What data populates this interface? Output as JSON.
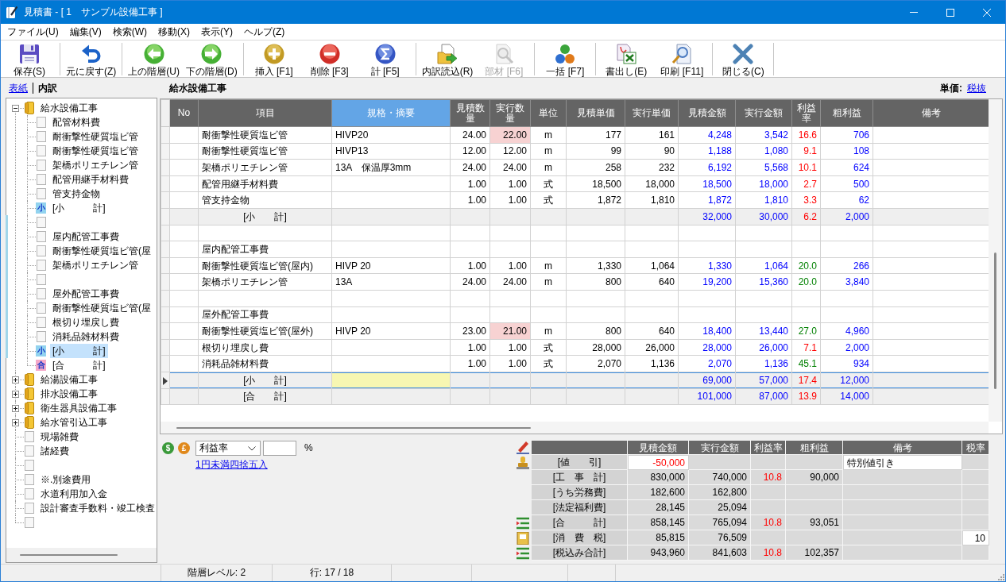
{
  "window": {
    "title": "見積書 - [ 1　サンプル設備工事 ]"
  },
  "menu": [
    "ファイル(U)",
    "編集(V)",
    "検索(W)",
    "移動(X)",
    "表示(Y)",
    "ヘルプ(Z)"
  ],
  "toolbar": [
    [
      {
        "kind": "save",
        "label": "保存(S)",
        "disabled": false
      }
    ],
    [
      {
        "kind": "undo",
        "label": "元に戻す(Z)",
        "disabled": false
      }
    ],
    [
      {
        "kind": "up",
        "label": "上の階層(U)",
        "disabled": false
      },
      {
        "kind": "down",
        "label": "下の階層(D)",
        "disabled": false
      }
    ],
    [
      {
        "kind": "insert",
        "label": "挿入 [F1]",
        "disabled": false
      },
      {
        "kind": "delete",
        "label": "削除 [F3]",
        "disabled": false
      },
      {
        "kind": "sum",
        "label": "計 [F5]",
        "disabled": false
      }
    ],
    [
      {
        "kind": "import",
        "label": "内訳読込(R)",
        "disabled": false
      },
      {
        "kind": "parts",
        "label": "部材 [F6]",
        "disabled": true
      }
    ],
    [
      {
        "kind": "batch",
        "label": "一括 [F7]",
        "disabled": false
      }
    ],
    [
      {
        "kind": "export",
        "label": "書出し(E)",
        "disabled": false
      },
      {
        "kind": "print",
        "label": "印刷 [F11]",
        "disabled": false
      }
    ],
    [
      {
        "kind": "close",
        "label": "閉じる(C)",
        "disabled": false
      }
    ]
  ],
  "left_panel": {
    "tabs": [
      {
        "label": "表紙",
        "selected": false
      },
      {
        "label": "内訳",
        "selected": true
      }
    ],
    "tree": [
      {
        "kind": "folder",
        "label": "給水設備工事",
        "expanded": true,
        "selected": false,
        "children": [
          {
            "kind": "doc",
            "label": "配管材料費",
            "selected": false
          },
          {
            "kind": "doc",
            "label": "耐衝撃性硬質塩ビ管",
            "selected": false
          },
          {
            "kind": "doc",
            "label": "耐衝撃性硬質塩ビ管",
            "selected": false
          },
          {
            "kind": "doc",
            "label": "架橋ポリエチレン管",
            "selected": false
          },
          {
            "kind": "doc",
            "label": "配管用継手材料費",
            "selected": false
          },
          {
            "kind": "doc",
            "label": "管支持金物",
            "selected": false
          },
          {
            "kind": "subtotal",
            "tag": "小",
            "label": "[小　　　計]",
            "selected": false
          },
          {
            "kind": "doc",
            "selected": false
          },
          {
            "kind": "doc",
            "label": "屋内配管工事費",
            "selected": false
          },
          {
            "kind": "doc",
            "label": "耐衝撃性硬質塩ビ管(屋",
            "selected": false
          },
          {
            "kind": "doc",
            "label": "架橋ポリエチレン管",
            "selected": false
          },
          {
            "kind": "doc",
            "selected": false
          },
          {
            "kind": "doc",
            "label": "屋外配管工事費",
            "selected": false
          },
          {
            "kind": "doc",
            "label": "耐衝撃性硬質塩ビ管(屋",
            "selected": false
          },
          {
            "kind": "doc",
            "label": "根切り埋戻し費",
            "selected": false
          },
          {
            "kind": "doc",
            "label": "消耗品雑材料費",
            "selected": false
          },
          {
            "kind": "subtotal",
            "tag": "小",
            "label": "[小　　　計]",
            "selected": true
          },
          {
            "kind": "total",
            "tag": "合",
            "label": "[合　　　計]",
            "selected": false
          }
        ]
      },
      {
        "kind": "folder",
        "label": "給湯設備工事",
        "expanded": false,
        "selected": false
      },
      {
        "kind": "folder",
        "label": "排水設備工事",
        "expanded": false,
        "selected": false
      },
      {
        "kind": "folder",
        "label": "衛生器具設備工事",
        "expanded": false,
        "selected": false
      },
      {
        "kind": "folder",
        "label": "給水管引込工事",
        "expanded": false,
        "selected": false
      },
      {
        "kind": "doc",
        "label": "現場雑費",
        "selected": false
      },
      {
        "kind": "doc",
        "label": "諸経費",
        "selected": false
      },
      {
        "kind": "doc",
        "selected": false
      },
      {
        "kind": "doc",
        "label": "※.別途費用",
        "selected": false
      },
      {
        "kind": "doc",
        "label": "水道利用加入金",
        "selected": false
      },
      {
        "kind": "doc",
        "label": "設計審査手数料・竣工検査",
        "selected": false
      },
      {
        "kind": "doc",
        "selected": false
      }
    ]
  },
  "main": {
    "title": "給水設備工事",
    "unit_price": {
      "label": "単価:",
      "link": "税抜"
    },
    "columns": [
      {
        "label": "No",
        "selected": false
      },
      {
        "label": "項目",
        "selected": false
      },
      {
        "label": "規格・摘要",
        "selected": true
      },
      {
        "label": "見積数量",
        "selected": false
      },
      {
        "label": "実行数量",
        "selected": false
      },
      {
        "label": "単位",
        "selected": false
      },
      {
        "label": "見積単価",
        "selected": false
      },
      {
        "label": "実行単価",
        "selected": false
      },
      {
        "label": "見積金額",
        "selected": false
      },
      {
        "label": "実行金額",
        "selected": false
      },
      {
        "label": "利益率",
        "selected": false
      },
      {
        "label": "粗利益",
        "selected": false
      },
      {
        "label": "備考",
        "selected": false
      }
    ],
    "rows": [
      {
        "kind": "line",
        "current": false,
        "qty_flag": true,
        "item": "耐衝撃性硬質塩ビ管",
        "spec": "HIVP20",
        "est_qty": "24.00",
        "act_qty": "22.00",
        "unit": "m",
        "est_price": "177",
        "act_price": "161",
        "est_amount": "4,248",
        "act_amount": "3,542",
        "rate": "16.6",
        "low_margin": true,
        "profit": "706"
      },
      {
        "kind": "line",
        "current": false,
        "qty_flag": false,
        "item": "耐衝撃性硬質塩ビ管",
        "spec": "HIVP13",
        "est_qty": "12.00",
        "act_qty": "12.00",
        "unit": "m",
        "est_price": "99",
        "act_price": "90",
        "est_amount": "1,188",
        "act_amount": "1,080",
        "rate": "9.1",
        "low_margin": true,
        "profit": "108"
      },
      {
        "kind": "line",
        "current": false,
        "qty_flag": false,
        "item": "架橋ポリエチレン管",
        "spec": "13A　保温厚3mm",
        "est_qty": "24.00",
        "act_qty": "24.00",
        "unit": "m",
        "est_price": "258",
        "act_price": "232",
        "est_amount": "6,192",
        "act_amount": "5,568",
        "rate": "10.1",
        "low_margin": true,
        "profit": "624"
      },
      {
        "kind": "line",
        "current": false,
        "qty_flag": false,
        "item": "配管用継手材料費",
        "est_qty": "1.00",
        "act_qty": "1.00",
        "unit": "式",
        "est_price": "18,500",
        "act_price": "18,000",
        "est_amount": "18,500",
        "act_amount": "18,000",
        "rate": "2.7",
        "low_margin": true,
        "profit": "500"
      },
      {
        "kind": "line",
        "current": false,
        "qty_flag": false,
        "item": "管支持金物",
        "est_qty": "1.00",
        "act_qty": "1.00",
        "unit": "式",
        "est_price": "1,872",
        "act_price": "1,810",
        "est_amount": "1,872",
        "act_amount": "1,810",
        "rate": "3.3",
        "low_margin": true,
        "profit": "62"
      },
      {
        "kind": "sum",
        "current": false,
        "qty_flag": false,
        "item": "[小　　計]",
        "est_amount": "32,000",
        "act_amount": "30,000",
        "rate": "6.2",
        "low_margin": true,
        "profit": "2,000"
      },
      {
        "kind": "line",
        "current": false,
        "qty_flag": false
      },
      {
        "kind": "line",
        "current": false,
        "qty_flag": false,
        "item": "屋内配管工事費"
      },
      {
        "kind": "line",
        "current": false,
        "qty_flag": false,
        "item": "耐衝撃性硬質塩ビ管(屋内)",
        "spec": "HIVP 20",
        "est_qty": "1.00",
        "act_qty": "1.00",
        "unit": "m",
        "est_price": "1,330",
        "act_price": "1,064",
        "est_amount": "1,330",
        "act_amount": "1,064",
        "rate": "20.0",
        "low_margin": false,
        "profit": "266"
      },
      {
        "kind": "line",
        "current": false,
        "qty_flag": false,
        "item": "架橋ポリエチレン管",
        "spec": "13A",
        "est_qty": "24.00",
        "act_qty": "24.00",
        "unit": "m",
        "est_price": "800",
        "act_price": "640",
        "est_amount": "19,200",
        "act_amount": "15,360",
        "rate": "20.0",
        "low_margin": false,
        "profit": "3,840"
      },
      {
        "kind": "line",
        "current": false,
        "qty_flag": false
      },
      {
        "kind": "line",
        "current": false,
        "qty_flag": false,
        "item": "屋外配管工事費"
      },
      {
        "kind": "line",
        "current": false,
        "qty_flag": true,
        "item": "耐衝撃性硬質塩ビ管(屋外)",
        "spec": "HIVP 20",
        "est_qty": "23.00",
        "act_qty": "21.00",
        "unit": "m",
        "est_price": "800",
        "act_price": "640",
        "est_amount": "18,400",
        "act_amount": "13,440",
        "rate": "27.0",
        "low_margin": false,
        "profit": "4,960"
      },
      {
        "kind": "line",
        "current": false,
        "qty_flag": false,
        "item": "根切り埋戻し費",
        "est_qty": "1.00",
        "act_qty": "1.00",
        "unit": "式",
        "est_price": "28,000",
        "act_price": "26,000",
        "est_amount": "28,000",
        "act_amount": "26,000",
        "rate": "7.1",
        "low_margin": true,
        "profit": "2,000"
      },
      {
        "kind": "line",
        "current": false,
        "qty_flag": false,
        "item": "消耗品雑材料費",
        "est_qty": "1.00",
        "act_qty": "1.00",
        "unit": "式",
        "est_price": "2,070",
        "act_price": "1,136",
        "est_amount": "2,070",
        "act_amount": "1,136",
        "rate": "45.1",
        "low_margin": false,
        "profit": "934"
      },
      {
        "kind": "sum",
        "current": true,
        "qty_flag": false,
        "item": "[小　　計]",
        "est_amount": "69,000",
        "act_amount": "57,000",
        "rate": "17.4",
        "low_margin": true,
        "profit": "12,000"
      },
      {
        "kind": "sum",
        "current": false,
        "qty_flag": false,
        "item": "[合　　計]",
        "est_amount": "101,000",
        "act_amount": "87,000",
        "rate": "13.9",
        "low_margin": true,
        "profit": "14,000"
      }
    ]
  },
  "bottom": {
    "currency_buttons": [
      {
        "symbol": "$",
        "color": "#3b9a3b"
      },
      {
        "symbol": "£",
        "color": "#e0891c"
      }
    ],
    "basis_select": {
      "value": "利益率"
    },
    "rate_input": {
      "unit": "%"
    },
    "rounding_link": "1円未満四捨五入",
    "summary": {
      "columns": [
        "見積金額",
        "実行金額",
        "利益率",
        "粗利益",
        "備考",
        "税率"
      ],
      "rows": [
        {
          "kind": "discount",
          "label": "[値　　引]",
          "cells": [
            {
              "text": "-50,000",
              "editable": true,
              "alert": true
            },
            {
              "editable": false
            },
            {
              "editable": false
            },
            {
              "editable": false
            },
            {
              "text": "特別値引き",
              "editable": true,
              "alert": false
            },
            {
              "editable": false
            }
          ]
        },
        {
          "kind": "plain",
          "label": "[工　事　計]",
          "cells": [
            {
              "text": "830,000",
              "editable": false,
              "alert": false
            },
            {
              "text": "740,000",
              "editable": false,
              "alert": false
            },
            {
              "text": "10.8",
              "editable": false,
              "alert": true
            },
            {
              "text": "90,000",
              "editable": false,
              "alert": false
            },
            {
              "editable": false
            },
            {
              "editable": false
            }
          ]
        },
        {
          "kind": "plain",
          "label": "[うち労務費]",
          "cells": [
            {
              "text": "182,600",
              "editable": false,
              "alert": false
            },
            {
              "text": "162,800",
              "editable": false,
              "alert": false
            },
            {
              "editable": false
            },
            {
              "editable": false
            },
            {
              "editable": false
            },
            {
              "editable": false
            }
          ]
        },
        {
          "kind": "plain",
          "label": "[法定福利費]",
          "cells": [
            {
              "text": "28,145",
              "editable": false,
              "alert": false
            },
            {
              "text": "25,094",
              "editable": false,
              "alert": false
            },
            {
              "editable": false
            },
            {
              "editable": false
            },
            {
              "editable": false
            },
            {
              "editable": false
            }
          ]
        },
        {
          "kind": "total",
          "label": "[合　　　計]",
          "cells": [
            {
              "text": "858,145",
              "editable": false,
              "alert": false
            },
            {
              "text": "765,094",
              "editable": false,
              "alert": false
            },
            {
              "text": "10.8",
              "editable": false,
              "alert": true
            },
            {
              "text": "93,051",
              "editable": false,
              "alert": false
            },
            {
              "editable": false
            },
            {
              "editable": false
            }
          ]
        },
        {
          "kind": "tax",
          "label": "[消　費　税]",
          "cells": [
            {
              "text": "85,815",
              "editable": false,
              "alert": false
            },
            {
              "text": "76,509",
              "editable": false,
              "alert": false
            },
            {
              "editable": false
            },
            {
              "editable": false
            },
            {
              "editable": false
            },
            {
              "text": "10",
              "editable": true,
              "alert": false
            }
          ]
        },
        {
          "kind": "total",
          "label": "[税込み合計]",
          "cells": [
            {
              "text": "943,960",
              "editable": false,
              "alert": false
            },
            {
              "text": "841,603",
              "editable": false,
              "alert": false
            },
            {
              "text": "10.8",
              "editable": false,
              "alert": true
            },
            {
              "text": "102,357",
              "editable": false,
              "alert": false
            },
            {
              "editable": false
            },
            {
              "editable": false
            }
          ]
        }
      ]
    }
  },
  "status_bar": [
    "階層レベル: 2",
    "行: 17 / 18"
  ]
}
